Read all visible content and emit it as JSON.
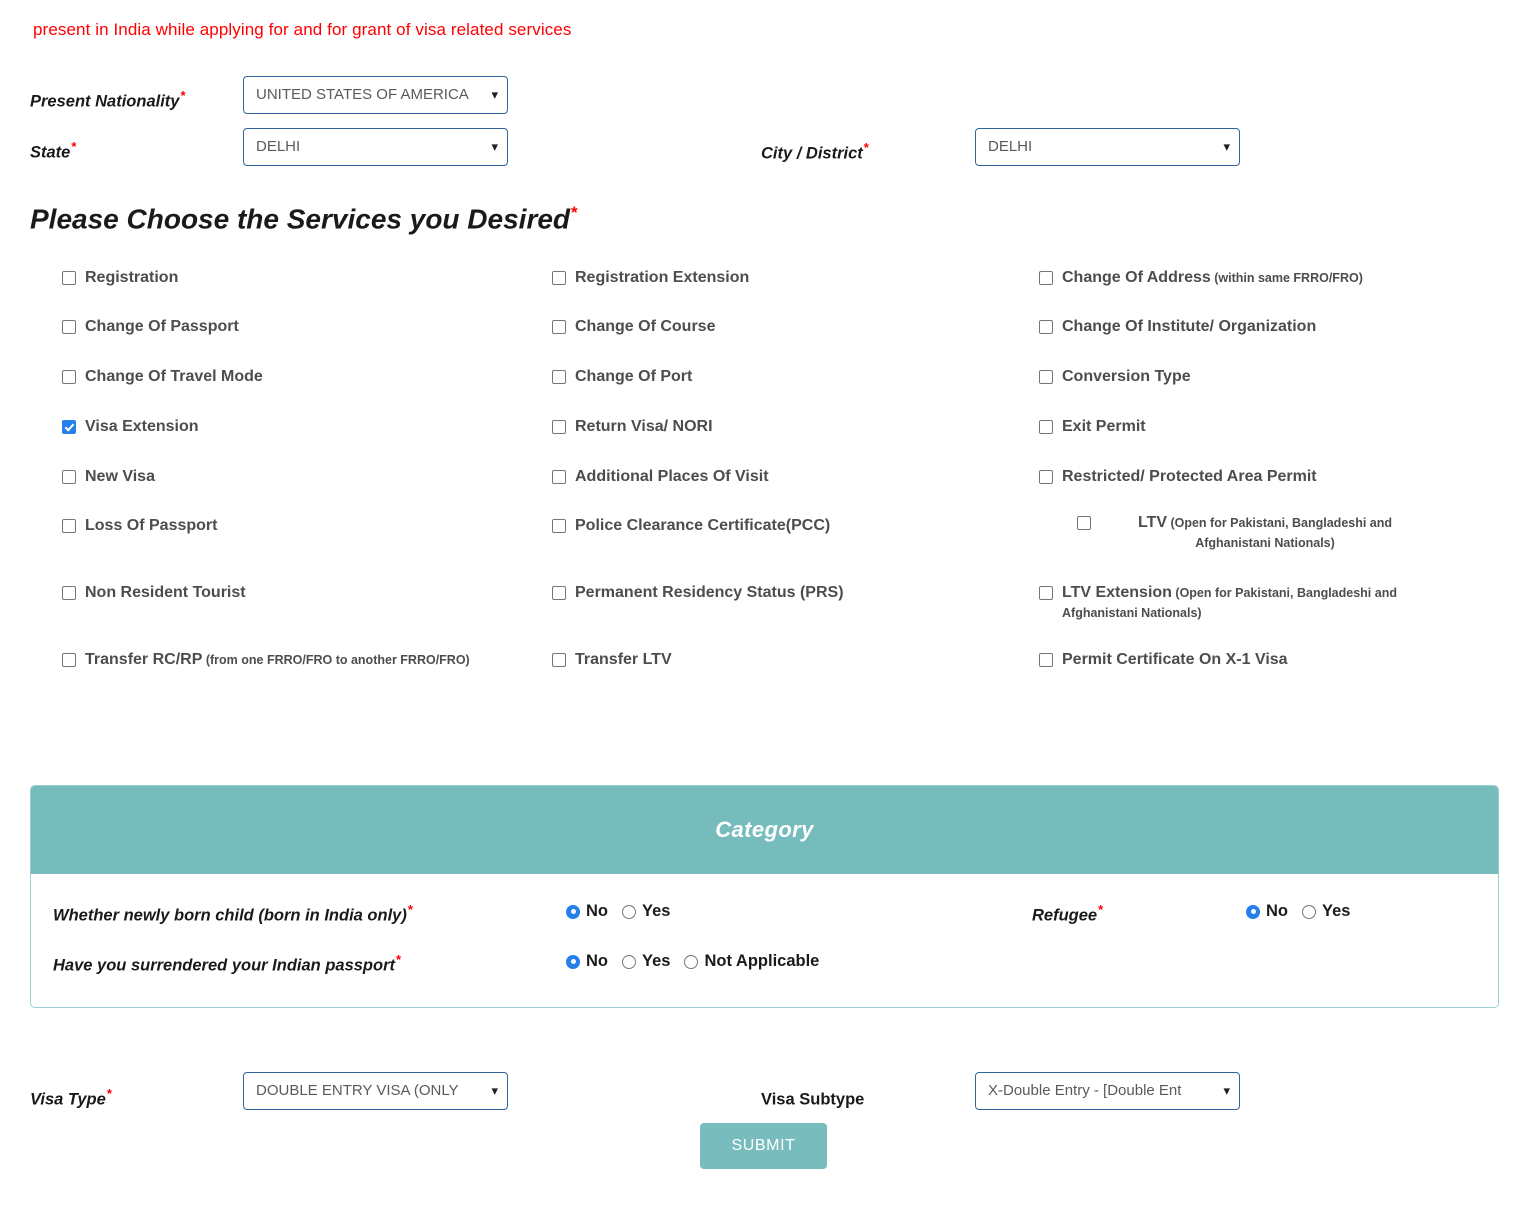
{
  "notice": "present in India while applying for and for grant of visa related services",
  "top_form": {
    "nationality": {
      "label": "Present Nationality",
      "value": "UNITED STATES OF AMERICA",
      "required": "*"
    },
    "state": {
      "label": "State",
      "value": "DELHI",
      "required": "*"
    },
    "city": {
      "label": "City / District",
      "value": "DELHI",
      "required": "*"
    }
  },
  "services": {
    "heading": "Please Choose the Services you Desired",
    "heading_required": "*",
    "column1": [
      {
        "label": "Registration",
        "sub": "",
        "checked": false
      },
      {
        "label": "Change Of Passport",
        "sub": "",
        "checked": false
      },
      {
        "label": "Change Of Travel Mode",
        "sub": "",
        "checked": false
      },
      {
        "label": "Visa Extension",
        "sub": "",
        "checked": true
      },
      {
        "label": "New Visa",
        "sub": "",
        "checked": false
      },
      {
        "label": "Loss Of Passport",
        "sub": "",
        "checked": false
      },
      {
        "label": "Non Resident Tourist",
        "sub": "",
        "checked": false
      },
      {
        "label": "Transfer RC/RP",
        "sub": "(from one FRRO/FRO to another FRRO/FRO)",
        "checked": false
      }
    ],
    "column2": [
      {
        "label": "Registration Extension",
        "sub": "",
        "checked": false
      },
      {
        "label": "Change Of Course",
        "sub": "",
        "checked": false
      },
      {
        "label": "Change Of Port",
        "sub": "",
        "checked": false
      },
      {
        "label": "Return Visa/ NORI",
        "sub": "",
        "checked": false
      },
      {
        "label": "Additional Places Of Visit",
        "sub": "",
        "checked": false
      },
      {
        "label": "Police Clearance Certificate(PCC)",
        "sub": "",
        "checked": false
      },
      {
        "label": "Permanent Residency Status (PRS)",
        "sub": "",
        "checked": false
      },
      {
        "label": "Transfer LTV",
        "sub": "",
        "checked": false
      }
    ],
    "column3": [
      {
        "label": "Change Of Address",
        "sub": "(within same FRRO/FRO)",
        "checked": false
      },
      {
        "label": "Change Of Institute/ Organization",
        "sub": "",
        "checked": false
      },
      {
        "label": "Conversion Type",
        "sub": "",
        "checked": false
      },
      {
        "label": "Exit Permit",
        "sub": "",
        "checked": false
      },
      {
        "label": "Restricted/ Protected Area Permit",
        "sub": "",
        "checked": false
      },
      {
        "label": "LTV",
        "sub": "(Open for Pakistani, Bangladeshi and Afghanistani Nationals)",
        "checked": false
      },
      {
        "label": "LTV Extension",
        "sub": "(Open for Pakistani, Bangladeshi and Afghanistani Nationals)",
        "checked": false
      },
      {
        "label": "Permit Certificate On X-1 Visa",
        "sub": "",
        "checked": false
      }
    ]
  },
  "category": {
    "title": "Category",
    "newborn": {
      "label": "Whether newly born child  (born in India only)",
      "required": "*",
      "options": [
        "No",
        "Yes"
      ],
      "selected": "No"
    },
    "surrendered": {
      "label": "Have you surrendered your Indian passport",
      "required": "*",
      "options": [
        "No",
        "Yes",
        "Not Applicable"
      ],
      "selected": "No"
    },
    "refugee": {
      "label": "Refugee",
      "required": "*",
      "options": [
        "No",
        "Yes"
      ],
      "selected": "No"
    }
  },
  "bottom_form": {
    "visa_type": {
      "label": "Visa Type",
      "required": "*",
      "value": "DOUBLE ENTRY VISA (ONLY"
    },
    "visa_subtype": {
      "label": "Visa Subtype",
      "required": "",
      "value": "X-Double Entry - [Double Ent"
    },
    "submit_label": "SUBMIT"
  },
  "colors": {
    "teal": "#76bcbd",
    "required_red": "#ff0000",
    "checkbox_blue": "#2680eb",
    "select_border": "#31659c"
  }
}
